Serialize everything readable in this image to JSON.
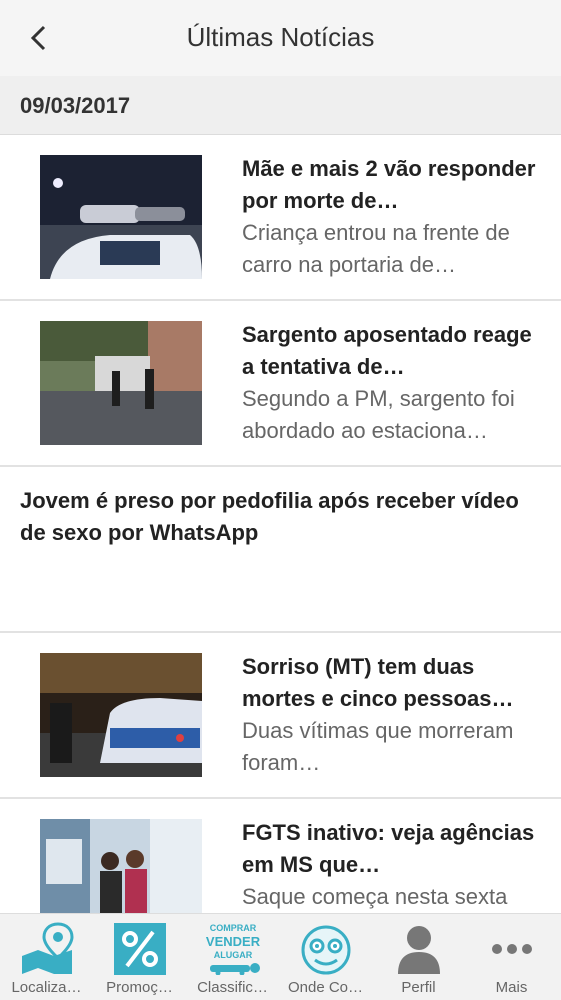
{
  "header": {
    "title": "Últimas Notícias"
  },
  "date": "09/03/2017",
  "news": [
    {
      "headline": "Mãe e mais 2 vão responder por morte de…",
      "summary": "Criança entrou na frente de carro na portaria de…"
    },
    {
      "headline": "Sargento aposentado reage a tentativa de…",
      "summary": "Segundo a PM, sargento foi abordado ao estaciona…"
    },
    {
      "headline": "Jovem é preso por pedofilia após receber vídeo de sexo por WhatsApp"
    },
    {
      "headline": "Sorriso (MT) tem duas mortes e cinco pessoas…",
      "summary": "Duas vítimas que morreram foram…"
    },
    {
      "headline": "FGTS inativo: veja agências em MS que…",
      "summary": "Saque começa nesta sexta"
    }
  ],
  "tabs": [
    {
      "label": "Localiza…",
      "icon": "map-pin-icon"
    },
    {
      "label": "Promoç…",
      "icon": "percent-icon"
    },
    {
      "label": "Classific…",
      "icon": "classified-icon",
      "badge_lines": [
        "COMPRAR",
        "VENDER",
        "ALUGAR"
      ]
    },
    {
      "label": "Onde Co…",
      "icon": "face-icon"
    },
    {
      "label": "Perfil",
      "icon": "person-icon"
    },
    {
      "label": "Mais",
      "icon": "more-icon"
    }
  ],
  "colors": {
    "accent": "#39aec4",
    "header_bg": "#f5f5f5",
    "date_bg": "#efefef"
  }
}
